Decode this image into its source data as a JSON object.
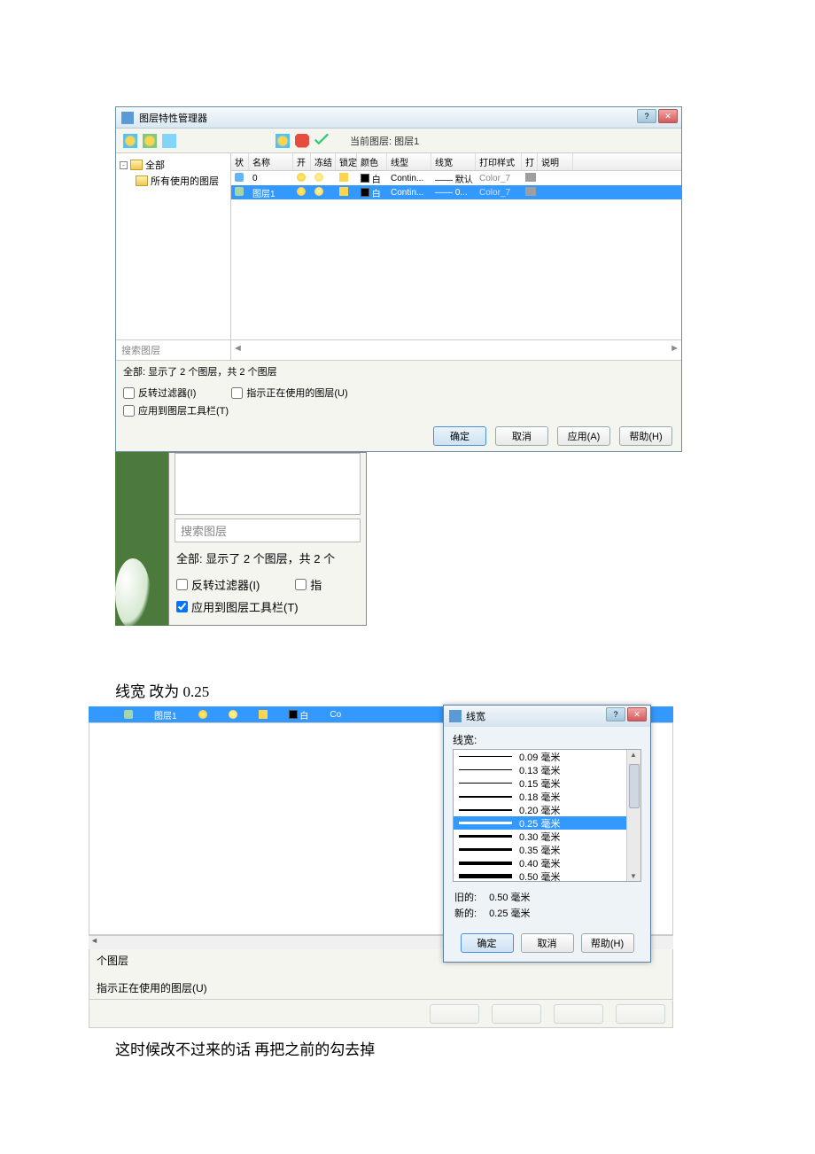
{
  "win1": {
    "title": "图层特性管理器",
    "current_layer_label": "当前图层: 图层1",
    "tree": {
      "root": "全部",
      "child": "所有使用的图层"
    },
    "columns": [
      "状",
      "名称",
      "开",
      "冻结",
      "锁定",
      "颜色",
      "线型",
      "线宽",
      "打印样式",
      "打",
      "说明"
    ],
    "rows": [
      {
        "name": "0",
        "color_label": "白",
        "linetype": "Contin...",
        "lineweight": "—— 默认",
        "plotstyle": "Color_7"
      },
      {
        "name": "图层1",
        "color_label": "白",
        "linetype": "Contin...",
        "lineweight": "—— 0...",
        "plotstyle": "Color_7"
      }
    ],
    "search_placeholder": "搜索图层",
    "status": "全部: 显示了 2 个图层，共 2 个图层",
    "chk_invert": "反转过滤器(I)",
    "chk_indicate": "指示正在使用的图层(U)",
    "chk_apply": "应用到图层工具栏(T)",
    "btn_ok": "确定",
    "btn_cancel": "取消",
    "btn_apply": "应用(A)",
    "btn_help": "帮助(H)"
  },
  "crop2": {
    "search": "搜索图层",
    "status": "全部: 显示了 2 个图层，共 2 个",
    "chk_invert": "反转过滤器(I)",
    "chk_indicate_prefix": "指",
    "chk_apply": "应用到图层工具栏(T)"
  },
  "caption1": "线宽  改为 0.25",
  "area3": {
    "strip_name": "图层1",
    "strip_color": "白",
    "strip_lt_prefix": "Co",
    "foot_line1": "个图层",
    "foot_line2": "指示正在使用的图层(U)"
  },
  "dlg3": {
    "title": "线宽",
    "label": "线宽:",
    "items": [
      "0.09 毫米",
      "0.13 毫米",
      "0.15 毫米",
      "0.18 毫米",
      "0.20 毫米",
      "0.25 毫米",
      "0.30 毫米",
      "0.35 毫米",
      "0.40 毫米",
      "0.50 毫米"
    ],
    "selected_index": 5,
    "old_label": "旧的:",
    "old_val": "0.50 毫米",
    "new_label": "新的:",
    "new_val": "0.25 毫米",
    "btn_ok": "确定",
    "btn_cancel": "取消",
    "btn_help": "帮助(H)"
  },
  "caption2": "这时候改不过来的话    再把之前的勾去掉"
}
